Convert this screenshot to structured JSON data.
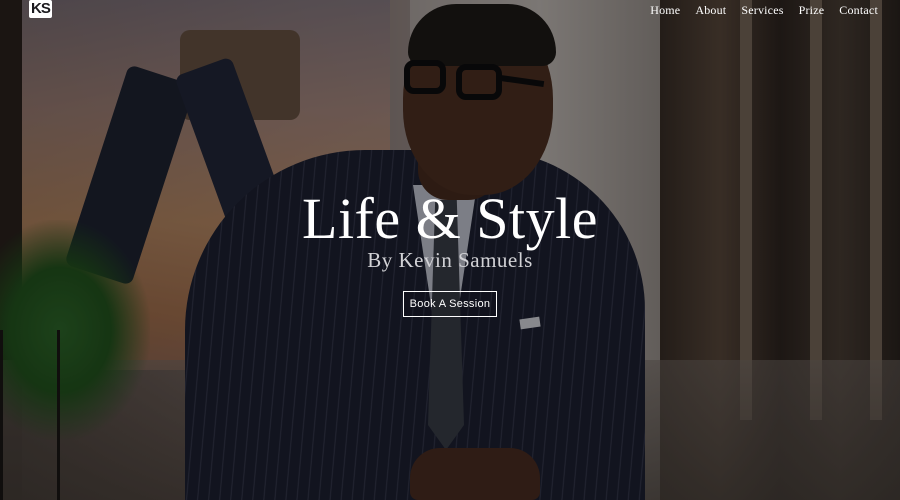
{
  "header": {
    "logo_text": "KS",
    "nav": [
      "Home",
      "About",
      "Services",
      "Prize",
      "Contact"
    ]
  },
  "hero": {
    "title": "Life & Style",
    "subtitle": "By Kevin Samuels",
    "cta_label": "Book A Session"
  }
}
